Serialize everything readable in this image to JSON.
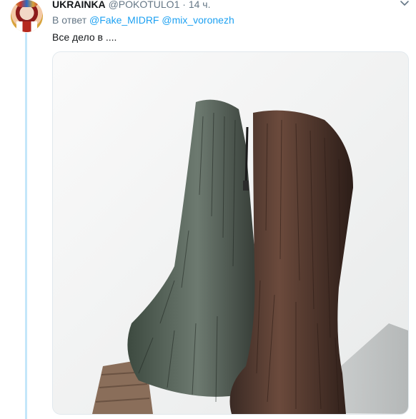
{
  "tweet": {
    "author_name": "UKRAINKA",
    "author_handle": "@POKOTULO1",
    "separator": " · ",
    "timestamp": "14 ч.",
    "reply_prefix": "В ответ",
    "mentions": [
      "@Fake_MIDRF",
      "@mix_voronezh"
    ],
    "text": "Все дело в ....",
    "media_alt": "fur boots photo"
  },
  "colors": {
    "accent": "#1da1f2",
    "thread_line": "#c4e7fa",
    "secondary_text": "#657786"
  },
  "icons": {
    "caret": "chevron-down-icon"
  }
}
